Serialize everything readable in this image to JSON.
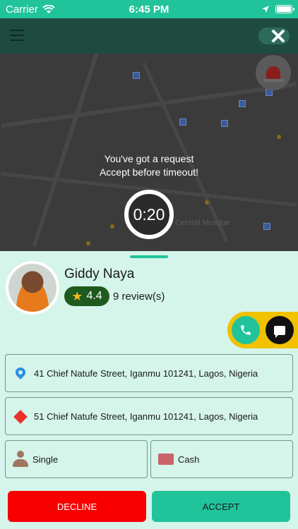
{
  "status_bar": {
    "carrier": "Carrier",
    "time": "6:45 PM"
  },
  "map": {
    "labels": [
      "Central Mosque"
    ]
  },
  "request": {
    "line1": "You've got a request",
    "line2": "Accept before timeout!",
    "countdown": "0:20"
  },
  "rider": {
    "name": "Giddy Naya",
    "rating": "4.4",
    "reviews": "9 review(s)"
  },
  "trip": {
    "pickup": "41 Chief Natufe Street, Iganmu 101241, Lagos, Nigeria",
    "dropoff": "51 Chief Natufe Street, Iganmu 101241, Lagos, Nigeria",
    "ride_type": "Single",
    "payment": "Cash"
  },
  "actions": {
    "decline": "DECLINE",
    "accept": "ACCEPT"
  },
  "colors": {
    "accent": "#21c49a",
    "decline": "#f80000",
    "contact_pill": "#f2c200",
    "sheet_bg": "#d5f4ea"
  }
}
